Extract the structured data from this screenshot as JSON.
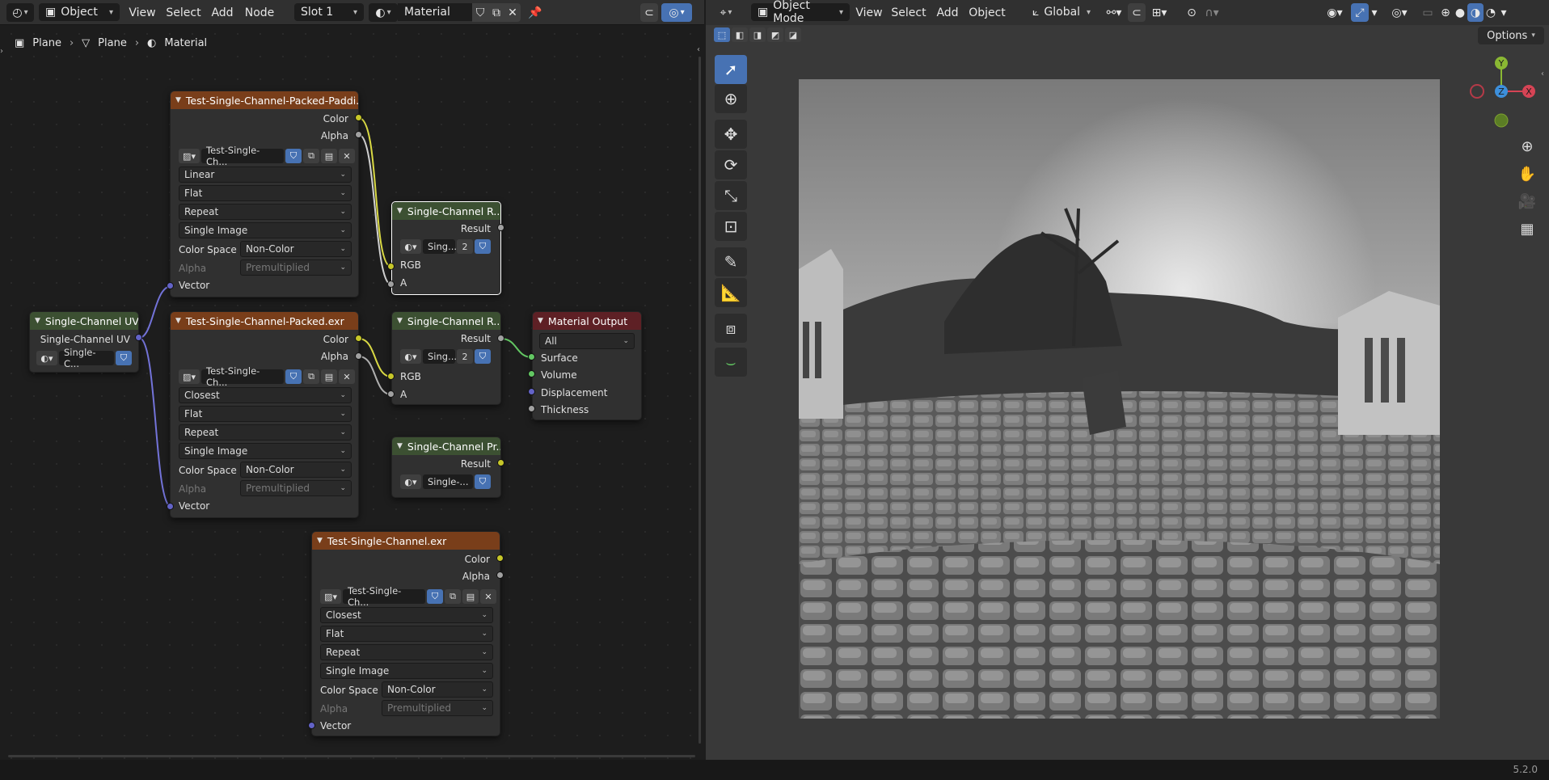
{
  "node_editor": {
    "header": {
      "mode": "Object",
      "menus": [
        "View",
        "Select",
        "Add",
        "Node"
      ],
      "slot": "Slot 1",
      "material_name": "Material"
    },
    "breadcrumb": [
      "Plane",
      "Plane",
      "Material"
    ],
    "nodes": {
      "tex_packed_padding": {
        "title": "Test-Single-Channel-Packed-Paddi...",
        "out_color": "Color",
        "out_alpha": "Alpha",
        "image": "Test-Single-Ch...",
        "interpolation": "Linear",
        "projection": "Flat",
        "extension": "Repeat",
        "source": "Single Image",
        "color_space_label": "Color Space",
        "color_space": "Non-Color",
        "alpha_label": "Alpha",
        "alpha": "Premultiplied",
        "in_vector": "Vector"
      },
      "tex_packed": {
        "title": "Test-Single-Channel-Packed.exr",
        "out_color": "Color",
        "out_alpha": "Alpha",
        "image": "Test-Single-Ch...",
        "interpolation": "Closest",
        "projection": "Flat",
        "extension": "Repeat",
        "source": "Single Image",
        "color_space_label": "Color Space",
        "color_space": "Non-Color",
        "alpha_label": "Alpha",
        "alpha": "Premultiplied",
        "in_vector": "Vector"
      },
      "tex_single": {
        "title": "Test-Single-Channel.exr",
        "out_color": "Color",
        "out_alpha": "Alpha",
        "image": "Test-Single-Ch...",
        "interpolation": "Closest",
        "projection": "Flat",
        "extension": "Repeat",
        "source": "Single Image",
        "color_space_label": "Color Space",
        "color_space": "Non-Color",
        "alpha_label": "Alpha",
        "alpha": "Premultiplied",
        "in_vector": "Vector"
      },
      "uv": {
        "title": "Single-Channel UV",
        "out_label": "Single-Channel UV",
        "group": "Single-C..."
      },
      "group_top": {
        "title": "Single-Channel R...",
        "out_result": "Result",
        "group": "Sing...",
        "users": "2",
        "in_rgb": "RGB",
        "in_a": "A"
      },
      "group_mid": {
        "title": "Single-Channel R...",
        "out_result": "Result",
        "group": "Sing...",
        "users": "2",
        "in_rgb": "RGB",
        "in_a": "A"
      },
      "group_pr": {
        "title": "Single-Channel Pr...",
        "out_result": "Result",
        "group": "Single-..."
      },
      "output": {
        "title": "Material Output",
        "target": "All",
        "in_surface": "Surface",
        "in_volume": "Volume",
        "in_displacement": "Displacement",
        "in_thickness": "Thickness"
      }
    }
  },
  "viewport": {
    "header": {
      "mode": "Object Mode",
      "menus": [
        "View",
        "Select",
        "Add",
        "Object"
      ],
      "orientation": "Global"
    },
    "options_label": "Options",
    "gizmo": {
      "y": "Y",
      "z": "Z",
      "x": "X"
    }
  },
  "status": {
    "version": "5.2.0"
  },
  "colors": {
    "accent": "#4772b3",
    "texture_header": "#793e1a",
    "group_header": "#3c5032",
    "output_header": "#5e2025"
  }
}
